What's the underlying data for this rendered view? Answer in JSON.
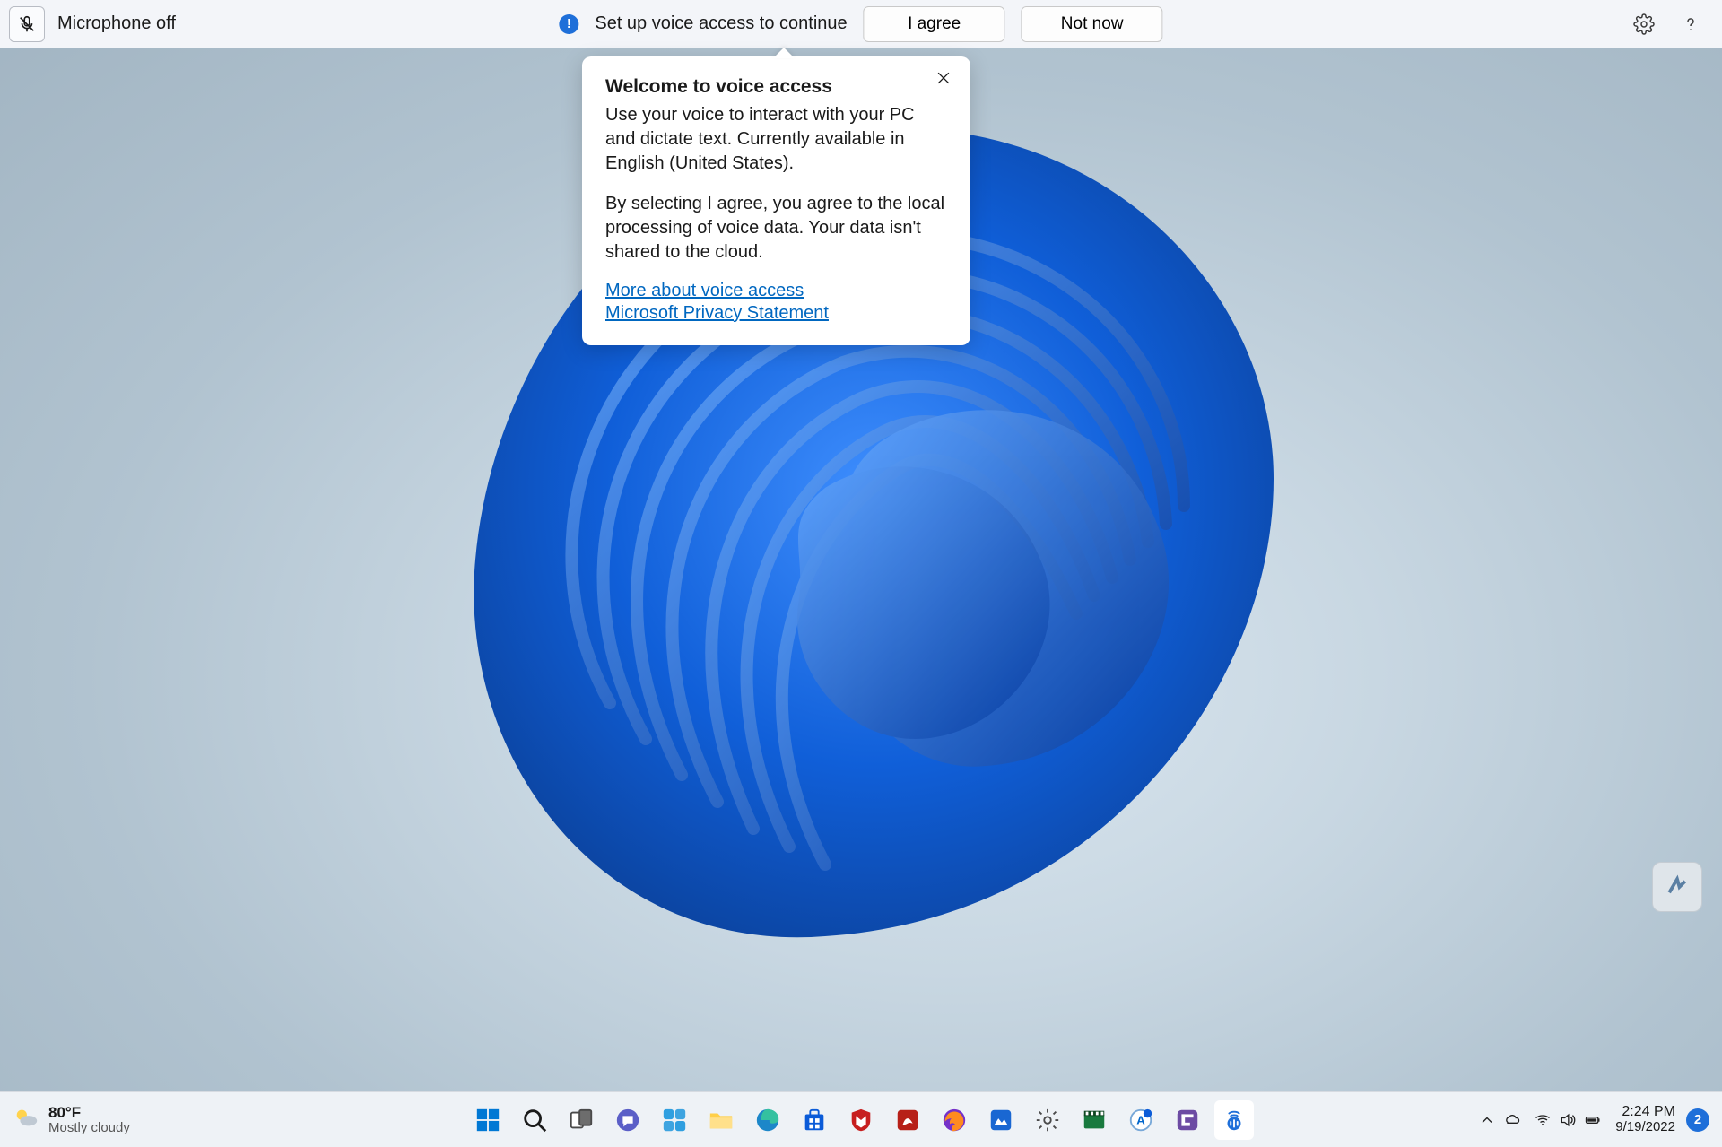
{
  "voice_access_bar": {
    "mic_label": "Microphone off",
    "setup_msg": "Set up voice access to continue",
    "agree_btn": "I agree",
    "notnow_btn": "Not now"
  },
  "voice_access_popup": {
    "title": "Welcome to voice access",
    "body1": "Use your voice to interact with your PC and dictate text. Currently available in English (United States).",
    "body2": "By selecting I agree, you agree to the local processing of voice data. Your data isn't shared to the cloud.",
    "link1": "More about voice access",
    "link2": "Microsoft Privacy Statement"
  },
  "taskbar": {
    "weather_temp": "80°F",
    "weather_cond": "Mostly cloudy",
    "time": "2:24 PM",
    "date": "9/19/2022",
    "notif_count": "2",
    "apps": [
      "start",
      "search",
      "task-view",
      "chat",
      "widgets",
      "file-explorer",
      "edge",
      "microsoft-store",
      "mcafee",
      "adobe-reader",
      "firefox",
      "screenshot-tool",
      "settings",
      "movies",
      "app-one",
      "clipchamp",
      "voice-access"
    ]
  }
}
